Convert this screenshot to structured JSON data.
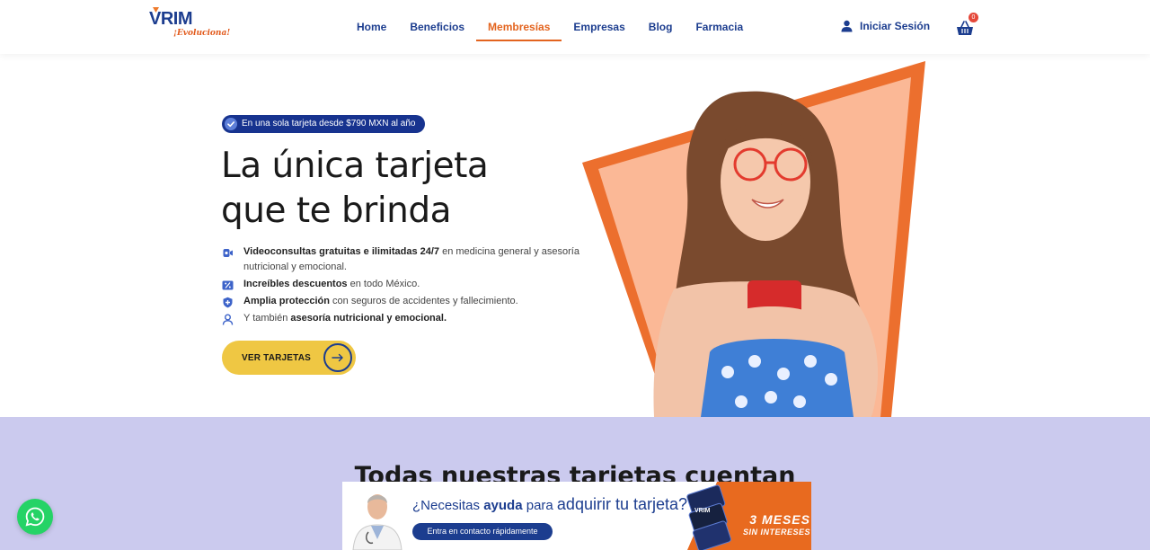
{
  "header": {
    "logo_text": "VRIM",
    "logo_tagline": "¡Evoluciona!",
    "nav": [
      {
        "label": "Home",
        "active": false
      },
      {
        "label": "Beneficios",
        "active": false
      },
      {
        "label": "Membresías",
        "active": true
      },
      {
        "label": "Empresas",
        "active": false
      },
      {
        "label": "Blog",
        "active": false
      },
      {
        "label": "Farmacia",
        "active": false
      }
    ],
    "login_label": "Iniciar Sesión",
    "login_icon": "user-icon",
    "cart_icon": "basket-icon",
    "cart_count": "0"
  },
  "hero": {
    "badge": "En una sola tarjeta desde $790 MXN al año",
    "headline_line1": "La única tarjeta",
    "headline_line2": "que te brinda",
    "features": [
      {
        "icon": "video-icon",
        "bold": "Videoconsultas gratuitas e ilimitadas 24/7",
        "text": " en medicina general y asesoría nutricional y emocional."
      },
      {
        "icon": "percent-icon",
        "bold": "Increíbles descuentos",
        "text": " en todo México."
      },
      {
        "icon": "shield-icon",
        "bold": "Amplia protección",
        "text": " con seguros de accidentes y fallecimiento."
      },
      {
        "icon": "person-icon",
        "prefix": "Y también ",
        "bold": "asesoría nutricional y emocional."
      }
    ],
    "cta_label": "VER TARJETAS",
    "cta_icon": "arrow-right-icon"
  },
  "section": {
    "title": "Todas nuestras tarjetas cuentan"
  },
  "banner": {
    "question_prefix": "¿Necesitas ",
    "question_bold": "ayuda",
    "question_mid": " para ",
    "question_big": "adquirir tu tarjeta?",
    "button_label": "Entra en contacto rápidamente",
    "promo_line1": "3 MESES",
    "promo_line2": "SIN INTERESES",
    "card_brand": "VRIM"
  },
  "colors": {
    "brand_blue": "#1c3d8f",
    "accent_orange": "#e3641f",
    "cta_yellow": "#efc743",
    "section_lavender": "#cbcaee",
    "whatsapp_green": "#25d366"
  },
  "whatsapp_icon": "whatsapp-icon"
}
